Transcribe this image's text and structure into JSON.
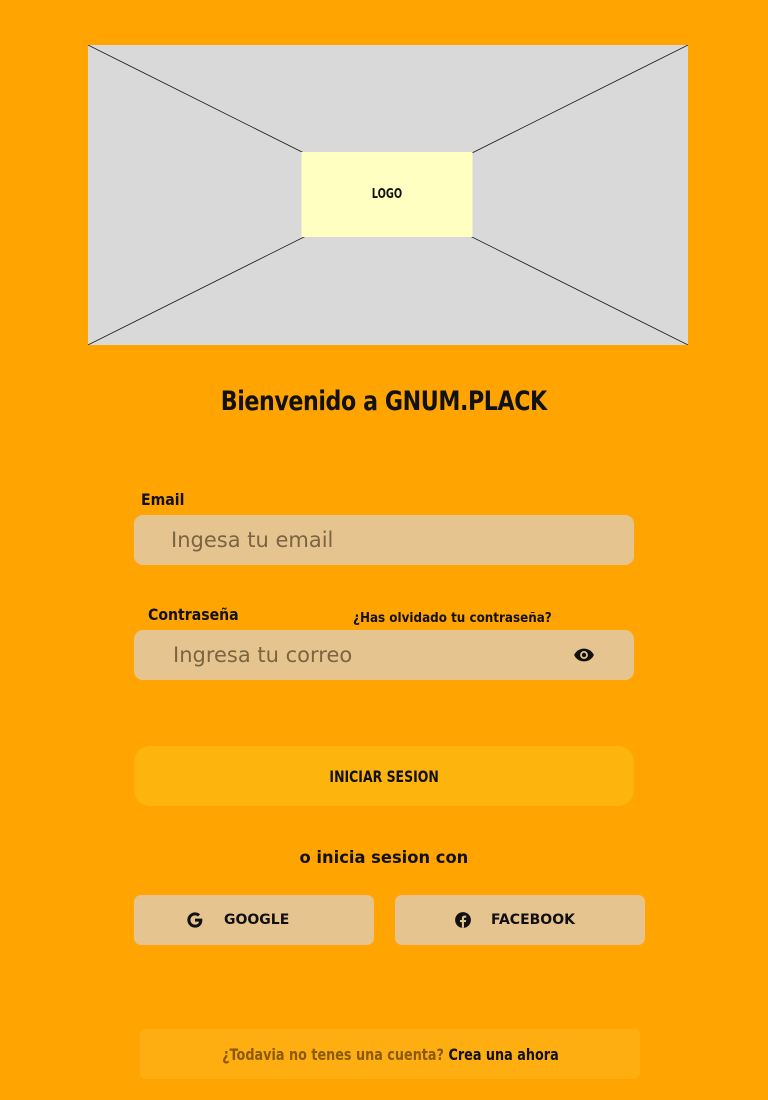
{
  "banner": {
    "logo_label": "LOGO"
  },
  "welcome": {
    "title": "Bienvenido a GNUM.PLACK"
  },
  "email": {
    "label": "Email",
    "placeholder": "Ingesa tu email",
    "value": ""
  },
  "password": {
    "label": "Contraseña",
    "placeholder": "Ingresa tu correo",
    "value": "",
    "forgot_link": "¿Has olvidado tu contraseña?",
    "toggle_icon": "eye-icon"
  },
  "login_button": {
    "label": "INICIAR SESION"
  },
  "social": {
    "divider_text": "o inicia sesion con",
    "google": {
      "label": "GOOGLE",
      "icon": "google-icon"
    },
    "facebook": {
      "label": "FACEBOOK",
      "icon": "facebook-icon"
    }
  },
  "signup": {
    "question": "¿Todavia no tenes una cuenta?",
    "link": "Crea una ahora"
  },
  "colors": {
    "background": "#FFA400",
    "input_bg": "#E6C490",
    "button_bg": "#FDB40C",
    "placeholder_image": "#D9D9D9",
    "logo_bg": "#FFFFC2",
    "signup_question": "#8A5A00"
  }
}
